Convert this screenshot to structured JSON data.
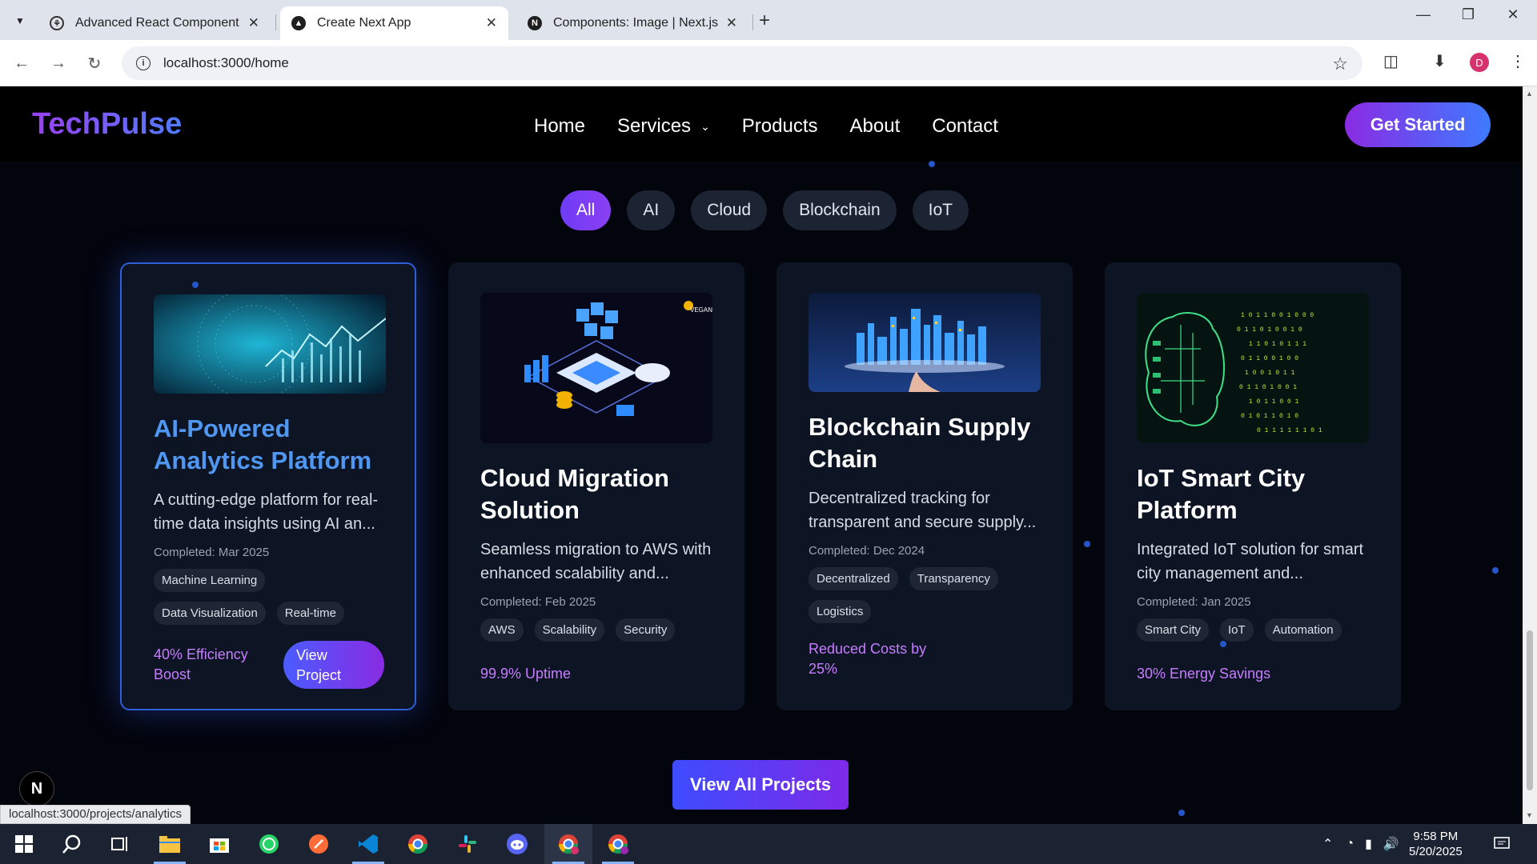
{
  "browser": {
    "tabs": [
      {
        "title": "Advanced React Component fo",
        "icon": "react-icon"
      },
      {
        "title": "Create Next App",
        "icon": "nextjs-icon"
      },
      {
        "title": "Components: Image | Next.js",
        "icon": "nextjs-icon"
      }
    ],
    "url": "localhost:3000/home",
    "profile_initial": "D"
  },
  "site": {
    "logo": "TechPulse",
    "nav": [
      "Home",
      "Services",
      "Products",
      "About",
      "Contact"
    ],
    "cta": "Get Started",
    "filters": [
      "All",
      "AI",
      "Cloud",
      "Blockchain",
      "IoT"
    ],
    "active_filter": "All",
    "projects": [
      {
        "title": "AI-Powered Analytics Platform",
        "desc": "A cutting-edge platform for real-time data insights using AI an...",
        "completed": "Completed: Mar 2025",
        "tags": [
          "Machine Learning",
          "Data Visualization",
          "Real-time"
        ],
        "metric": "40% Efficiency Boost",
        "button": "View Project"
      },
      {
        "title": "Cloud Migration Solution",
        "desc": "Seamless migration to AWS with enhanced scalability and...",
        "completed": "Completed: Feb 2025",
        "tags": [
          "AWS",
          "Scalability",
          "Security"
        ],
        "metric": "99.9% Uptime"
      },
      {
        "title": "Blockchain Supply Chain",
        "desc": "Decentralized tracking for transparent and secure supply...",
        "completed": "Completed: Dec 2024",
        "tags": [
          "Decentralized",
          "Transparency",
          "Logistics"
        ],
        "metric": "Reduced Costs by 25%"
      },
      {
        "title": "IoT Smart City Platform",
        "desc": "Integrated IoT solution for smart city management and...",
        "completed": "Completed: Jan 2025",
        "tags": [
          "Smart City",
          "IoT",
          "Automation"
        ],
        "metric": "30% Energy Savings"
      }
    ],
    "view_all": "View All Projects",
    "thumb_brand": "VEGAN"
  },
  "next_badge": "N",
  "status_url": "localhost:3000/projects/analytics",
  "taskbar": {
    "time": "9:58 PM",
    "date": "5/20/2025"
  },
  "colors": {
    "accent_purple": "#8a2be2",
    "accent_blue": "#3e7bff",
    "card_bg": "#0d1424",
    "metric": "#c77dff",
    "active_title": "#4f97f0"
  }
}
